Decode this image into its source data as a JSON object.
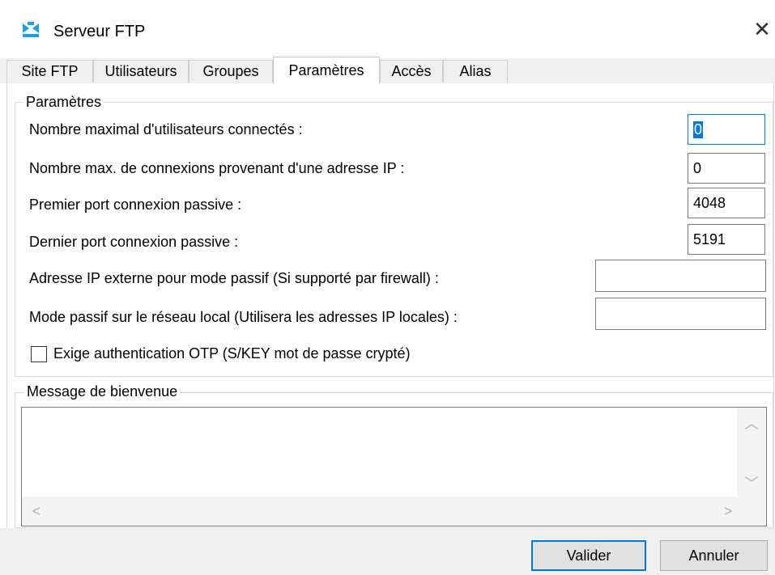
{
  "window": {
    "title": "Serveur FTP",
    "icon": "ftp-server-icon",
    "close_glyph": "✕"
  },
  "tabs": [
    {
      "label": "Site FTP",
      "active": false
    },
    {
      "label": "Utilisateurs",
      "active": false
    },
    {
      "label": "Groupes",
      "active": false
    },
    {
      "label": "Paramètres",
      "active": true
    },
    {
      "label": "Accès",
      "active": false
    },
    {
      "label": "Alias",
      "active": false
    }
  ],
  "parametres": {
    "legend": "Paramètres",
    "fields": [
      {
        "label": "Nombre maximal d'utilisateurs connectés :",
        "value": "0"
      },
      {
        "label": "Nombre max. de connexions provenant d'une adresse IP :",
        "value": "0"
      },
      {
        "label": "Premier port connexion passive :",
        "value": "4048"
      },
      {
        "label": "Dernier port connexion passive :",
        "value": "5191"
      },
      {
        "label": "Adresse IP externe pour mode passif (Si supporté par firewall) :",
        "value": ""
      },
      {
        "label": "Mode passif sur le réseau local (Utilisera les adresses IP locales) :",
        "value": ""
      }
    ],
    "otp_checkbox": {
      "label": "Exige authentication OTP (S/KEY mot de passe crypté)",
      "checked": false
    }
  },
  "welcome": {
    "legend": "Message de bienvenue",
    "text": ""
  },
  "scroll": {
    "up": "︿",
    "down": "﹀",
    "left": "<",
    "right": ">"
  },
  "footer": {
    "ok_label": "Valider",
    "cancel_label": "Annuler"
  },
  "colors": {
    "accent": "#0078d7",
    "icon_color": "#1ba1e2"
  }
}
